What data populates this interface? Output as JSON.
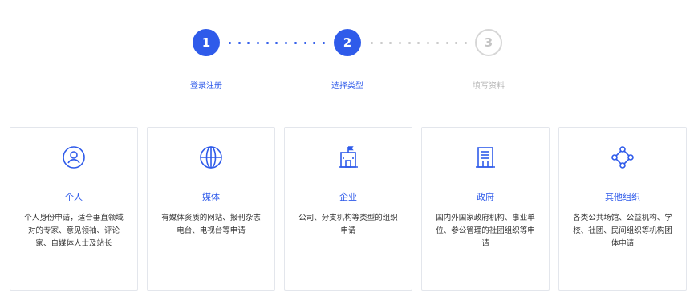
{
  "colors": {
    "accent": "#2f5bea",
    "inactive": "#b8b8b8",
    "border": "#e3e6ec"
  },
  "stepper": {
    "steps": [
      {
        "number": "1",
        "label": "登录注册",
        "state": "done"
      },
      {
        "number": "2",
        "label": "选择类型",
        "state": "current"
      },
      {
        "number": "3",
        "label": "填写资料",
        "state": "pending"
      }
    ]
  },
  "cards": [
    {
      "icon": "user-circle-icon",
      "title": "个人",
      "desc": "个人身份申请，适合垂直领域对的专家、意见领袖、评论家、自媒体人士及站长"
    },
    {
      "icon": "globe-icon",
      "title": "媒体",
      "desc": "有媒体资质的网站、报刊杂志电台、电视台等申请"
    },
    {
      "icon": "building-flag-icon",
      "title": "企业",
      "desc": "公司、分支机构等类型的组织申请"
    },
    {
      "icon": "government-building-icon",
      "title": "政府",
      "desc": "国内外国家政府机构、事业单位、参公管理的社团组织等申请"
    },
    {
      "icon": "network-nodes-icon",
      "title": "其他组织",
      "desc": "各类公共场馆、公益机构、学校、社团、民间组织等机构团体申请"
    }
  ]
}
